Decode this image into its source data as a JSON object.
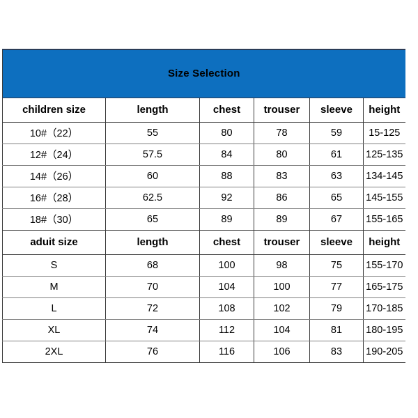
{
  "title": "Size Selection",
  "accent_color": "#0d6fbf",
  "columns": [
    "children size",
    "length",
    "chest",
    "trouser",
    "sleeve",
    "height"
  ],
  "sections": [
    {
      "header": [
        "children size",
        "length",
        "chest",
        "trouser",
        "sleeve",
        "height"
      ],
      "rows": [
        [
          "10#（22）",
          "55",
          "80",
          "78",
          "59",
          "15-125"
        ],
        [
          "12#（24）",
          "57.5",
          "84",
          "80",
          "61",
          "125-135"
        ],
        [
          "14#（26）",
          "60",
          "88",
          "83",
          "63",
          "134-145"
        ],
        [
          "16#（28）",
          "62.5",
          "92",
          "86",
          "65",
          "145-155"
        ],
        [
          "18#（30）",
          "65",
          "89",
          "89",
          "67",
          "155-165"
        ]
      ]
    },
    {
      "header": [
        "aduit size",
        "length",
        "chest",
        "trouser",
        "sleeve",
        "height"
      ],
      "rows": [
        [
          "S",
          "68",
          "100",
          "98",
          "75",
          "155-170"
        ],
        [
          "M",
          "70",
          "104",
          "100",
          "77",
          "165-175"
        ],
        [
          "L",
          "72",
          "108",
          "102",
          "79",
          "170-185"
        ],
        [
          "XL",
          "74",
          "112",
          "104",
          "81",
          "180-195"
        ],
        [
          "2XL",
          "76",
          "116",
          "106",
          "83",
          "190-205"
        ]
      ]
    }
  ]
}
